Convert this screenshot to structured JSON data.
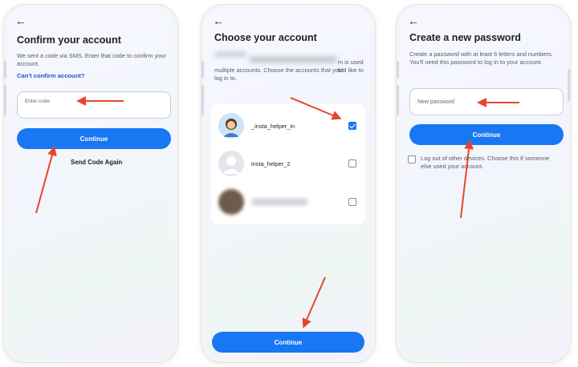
{
  "screen1": {
    "title": "Confirm your account",
    "description": "We sent a code via SMS. Enter that code to confirm your account.",
    "link": "Can't confirm account?",
    "input_placeholder": "Enter code",
    "continue_label": "Continue",
    "resend_label": "Send Code Again"
  },
  "screen2": {
    "title": "Choose your account",
    "description_visible_1": "m is used for",
    "description_visible_2": "multiple accounts. Choose the accounts that you'd like to log in to.",
    "accounts": [
      {
        "username": "_insta_helper_in",
        "checked": true
      },
      {
        "username": "insta_helper_2",
        "checked": false
      },
      {
        "username": "",
        "checked": false
      }
    ],
    "continue_label": "Continue"
  },
  "screen3": {
    "title": "Create a new password",
    "description": "Create a password with at least 6 letters and numbers. You'll need this password to log in to your account.",
    "input_placeholder": "New password",
    "continue_label": "Continue",
    "logout_text": "Log out of other devices. Choose this if someone else used your account.",
    "logout_checked": false
  },
  "colors": {
    "primary": "#1877f2",
    "link": "#1a56c9",
    "annotation_arrow": "#e8452c"
  },
  "icons": {
    "back": "back-arrow-icon",
    "checkbox": "checkbox-icon",
    "annotation": "red-annotation-arrow"
  }
}
